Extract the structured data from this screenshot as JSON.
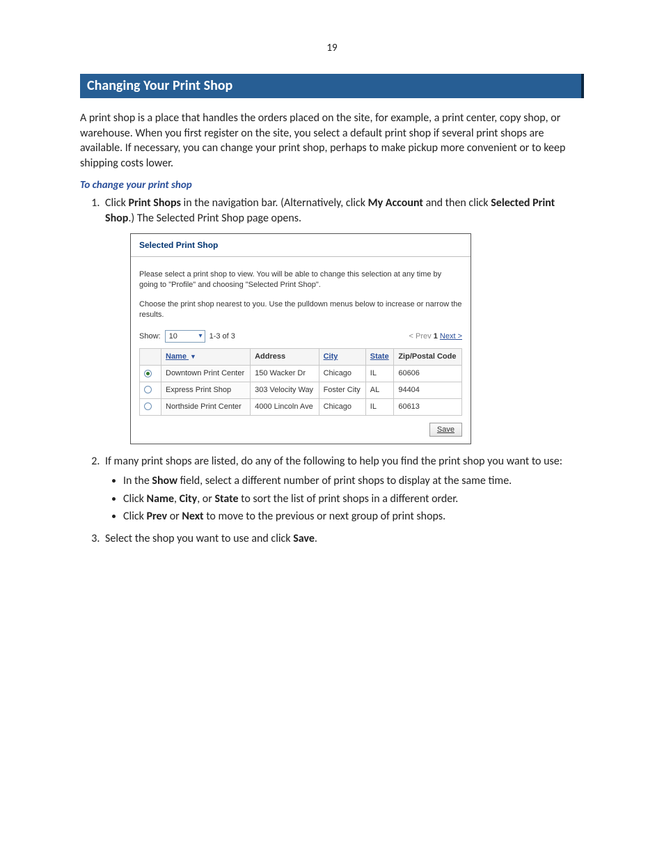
{
  "page_number": "19",
  "heading": "Changing Your Print Shop",
  "intro": "A print shop is a place that handles the orders placed on the site, for example, a print center, copy shop, or warehouse. When you first register on the site, you select a default print shop if several print shops are available. If necessary, you can change your print shop, perhaps to make pickup more convenient or to keep shipping costs lower.",
  "subheading": "To change your print shop",
  "steps": {
    "step1": {
      "pre": "Click ",
      "b1": "Print Shops",
      "mid1": " in the navigation bar. (Alternatively, click ",
      "b2": "My Account",
      "mid2": " and then click ",
      "b3": "Selected Print Shop",
      "post": ".) The Selected Print Shop page opens."
    },
    "step2": {
      "text": "If many print shops are listed, do any of the following to help you find the print shop you want to use:",
      "bullets": {
        "a_pre": "In the ",
        "a_b": "Show",
        "a_post": " field, select a different number of print shops to display at the same time.",
        "b_pre": "Click ",
        "b_b1": "Name",
        "b_mid1": ", ",
        "b_b2": "City",
        "b_mid2": ", or ",
        "b_b3": "State",
        "b_post": " to sort the list of print shops in a different order.",
        "c_pre": "Click ",
        "c_b1": "Prev",
        "c_mid": " or ",
        "c_b2": "Next",
        "c_post": " to move to the previous or next group of print shops."
      }
    },
    "step3": {
      "pre": "Select the shop you want to use and click ",
      "b": "Save",
      "post": "."
    }
  },
  "figure": {
    "title": "Selected Print Shop",
    "msg1": "Please select a print shop to view. You will be able to change this selection at any time by going to \"Profile\" and choosing \"Selected Print Shop\".",
    "msg2": "Choose the print shop nearest to you. Use the pulldown menus below to increase or narrow the results.",
    "show_label": "Show:",
    "show_value": "10",
    "count_label": "1-3 of 3",
    "pager": {
      "prev": "< Prev",
      "page": "1",
      "next": "Next >"
    },
    "columns": {
      "name": "Name",
      "sort_glyph": "▼",
      "address": "Address",
      "city": "City",
      "state": "State",
      "zip": "Zip/Postal Code"
    },
    "rows": [
      {
        "selected": true,
        "name": "Downtown Print Center",
        "address": "150 Wacker Dr",
        "city": "Chicago",
        "state": "IL",
        "zip": "60606"
      },
      {
        "selected": false,
        "name": "Express Print Shop",
        "address": "303 Velocity Way",
        "city": "Foster City",
        "state": "AL",
        "zip": "94404"
      },
      {
        "selected": false,
        "name": "Northside Print Center",
        "address": "4000 Lincoln Ave",
        "city": "Chicago",
        "state": "IL",
        "zip": "60613"
      }
    ],
    "save_label": "Save"
  }
}
